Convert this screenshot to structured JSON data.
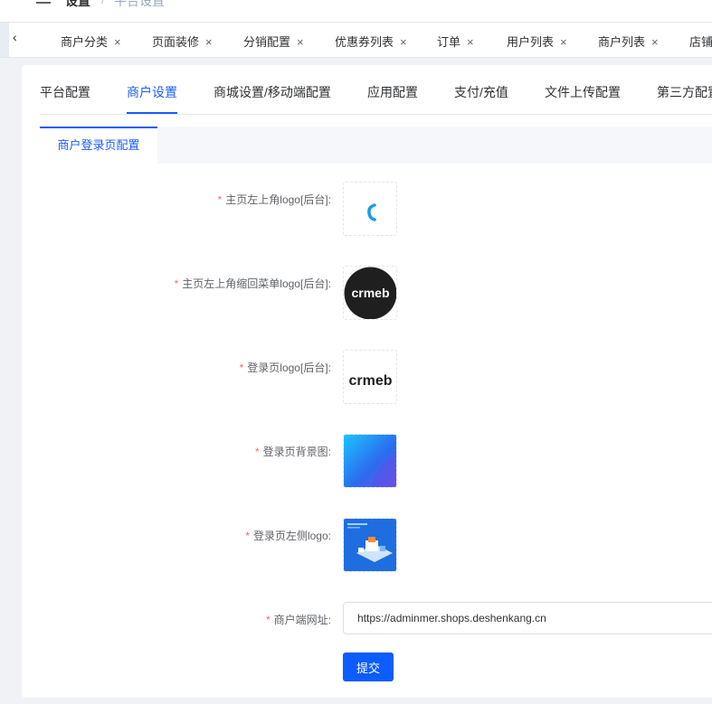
{
  "breadcrumb": {
    "root": "设置",
    "separator": "/",
    "current": "平台设置"
  },
  "tabs_bar": {
    "scroll_left": "‹",
    "tabs": [
      {
        "label": "商户分类"
      },
      {
        "label": "页面装修"
      },
      {
        "label": "分销配置"
      },
      {
        "label": "优惠券列表"
      },
      {
        "label": "订单"
      },
      {
        "label": "用户列表"
      },
      {
        "label": "商户列表"
      },
      {
        "label": "店铺"
      }
    ],
    "close_glyph": "×"
  },
  "main_tabs": [
    {
      "label": "平台配置",
      "active": false
    },
    {
      "label": "商户设置",
      "active": true
    },
    {
      "label": "商城设置/移动端配置",
      "active": false
    },
    {
      "label": "应用配置",
      "active": false
    },
    {
      "label": "支付/充值",
      "active": false
    },
    {
      "label": "文件上传配置",
      "active": false
    },
    {
      "label": "第三方配置",
      "active": false
    }
  ],
  "sub_tab": {
    "label": "商户登录页配置"
  },
  "form": {
    "required_mark": "*",
    "fields": [
      {
        "label": "主页左上角logo[后台]:"
      },
      {
        "label": "主页左上角缩回菜单logo[后台]:"
      },
      {
        "label": "登录页logo[后台]:"
      },
      {
        "label": "登录页背景图:"
      },
      {
        "label": "登录页左侧logo:"
      },
      {
        "label": "商户端网址:"
      }
    ],
    "logo_text": "crmeb",
    "url_value": "https://adminmer.shops.deshenkang.cn",
    "submit_label": "提交"
  },
  "colors": {
    "primary": "#1a5cff",
    "required": "#f56c6c"
  }
}
